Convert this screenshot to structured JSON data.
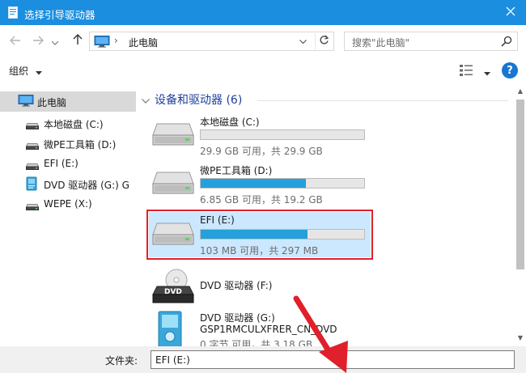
{
  "window": {
    "title": "选择引导驱动器",
    "icons": {
      "app": "document-icon",
      "close": "close-icon"
    }
  },
  "nav": {
    "address_crumb": "此电脑",
    "address_separator": "›",
    "search_placeholder": "搜索\"此电脑\"",
    "icons": [
      "back-arrow-icon",
      "forward-arrow-icon",
      "recent-dropdown-icon",
      "up-arrow-icon",
      "computer-icon",
      "chevron-down-icon",
      "refresh-icon",
      "search-icon"
    ]
  },
  "toolbar": {
    "organize_label": "组织",
    "help_label": "?",
    "icons": [
      "view-options-icon",
      "caret-down-icon",
      "help-icon"
    ]
  },
  "sidebar": {
    "items": [
      {
        "label": "此电脑",
        "icon": "computer-icon",
        "selected": true
      },
      {
        "label": "本地磁盘 (C:)",
        "icon": "drive-icon",
        "selected": false
      },
      {
        "label": "微PE工具箱 (D:)",
        "icon": "drive-icon",
        "selected": false
      },
      {
        "label": "EFI (E:)",
        "icon": "drive-icon",
        "selected": false
      },
      {
        "label": "DVD 驱动器 (G:) G",
        "icon": "dvd-installer-icon",
        "selected": false
      },
      {
        "label": "WEPE (X:)",
        "icon": "drive-icon",
        "selected": false
      }
    ]
  },
  "main": {
    "group_header": "设备和驱动器 (6)",
    "drives": [
      {
        "name": "本地磁盘 (C:)",
        "info": "29.9 GB 可用，共 29.9 GB",
        "used_fraction": 0.0,
        "icon": "hard-drive-icon",
        "selected": false
      },
      {
        "name": "微PE工具箱 (D:)",
        "info": "6.85 GB 可用，共 19.2 GB",
        "used_fraction": 0.643,
        "icon": "hard-drive-icon",
        "selected": false
      },
      {
        "name": "EFI (E:)",
        "info": "103 MB 可用，共 297 MB",
        "used_fraction": 0.653,
        "icon": "hard-drive-icon",
        "selected": true
      },
      {
        "name": "DVD 驱动器 (F:)",
        "icon": "dvd-drive-icon",
        "selected": false
      },
      {
        "name": "DVD 驱动器 (G:)",
        "name2": "GSP1RMCULXFRER_CN_DVD",
        "info": "0 字节 可用，共 3.18 GB",
        "icon": "dvd-installer-icon",
        "selected": false
      }
    ]
  },
  "footer": {
    "filename_label": "文件夹:",
    "filename_value": "EFI (E:)"
  },
  "annotation": {
    "arrow_color": "#e0202a",
    "highlight_color": "#e0202a"
  },
  "colors": {
    "titlebar": "#1b8ee0",
    "progress_fill": "#26a0da",
    "selection": "#cce8ff",
    "header_text": "#1e3e9e"
  }
}
